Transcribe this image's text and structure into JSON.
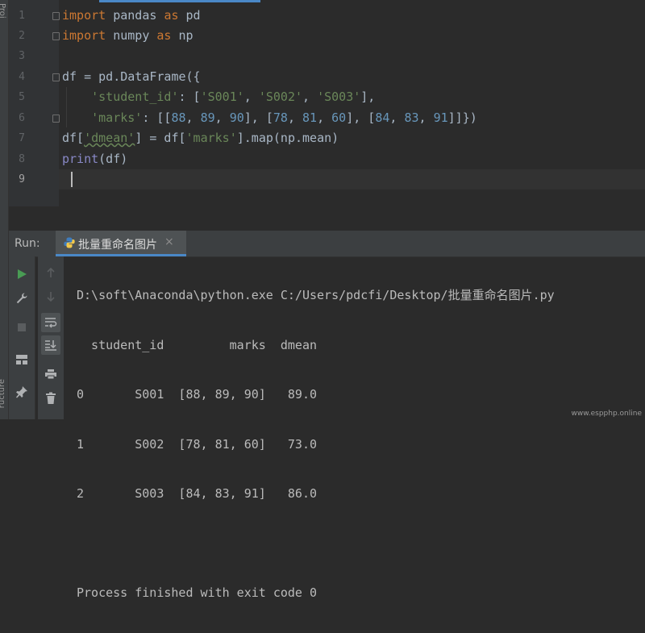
{
  "left_strip": {
    "top_label": "Proj",
    "bottom_label": "ructure"
  },
  "editor": {
    "line_numbers": [
      "1",
      "2",
      "3",
      "4",
      "5",
      "6",
      "7",
      "8",
      "9"
    ],
    "lines": {
      "l1": [
        "import",
        " pandas ",
        "as",
        " pd"
      ],
      "l2": [
        "import",
        " numpy ",
        "as",
        " np"
      ],
      "l4": [
        "df = pd.DataFrame({"
      ],
      "l5": [
        "    ",
        "'student_id'",
        ": [",
        "'S001'",
        ", ",
        "'S002'",
        ", ",
        "'S003'",
        "],"
      ],
      "l6": [
        "    ",
        "'marks'",
        ": [[",
        "88",
        ", ",
        "89",
        ", ",
        "90",
        "], [",
        "78",
        ", ",
        "81",
        ", ",
        "60",
        "], [",
        "84",
        ", ",
        "83",
        ", ",
        "91",
        "]]})"
      ],
      "l7": [
        "df[",
        "'dmean'",
        "] = df[",
        "'marks'",
        "].map(np.mean)"
      ],
      "l8": [
        "print",
        "(df)"
      ]
    }
  },
  "run": {
    "label": "Run:",
    "tab_label": "批量重命名图片",
    "tab_close": "×",
    "output": [
      "D:\\soft\\Anaconda\\python.exe C:/Users/pdcfi/Desktop/批量重命名图片.py",
      "  student_id         marks  dmean",
      "0       S001  [88, 89, 90]   89.0",
      "1       S002  [78, 81, 60]   73.0",
      "2       S003  [84, 83, 91]   86.0",
      "",
      "Process finished with exit code 0"
    ],
    "tools_left": [
      "run-icon",
      "wrench-icon",
      "stop-icon",
      "layout-icon",
      "pin-icon"
    ],
    "tools_right": [
      "arrow-up-icon",
      "arrow-down-icon",
      "soft-wrap-icon",
      "scroll-to-end-icon",
      "print-icon",
      "trash-icon"
    ]
  },
  "watermark": "www.espphp.online",
  "colors": {
    "keyword": "#cc7832",
    "string": "#6a8759",
    "number": "#6897bb",
    "builtin": "#8888c6",
    "text": "#a9b7c6",
    "accent": "#4a88c7",
    "run_green": "#499c54"
  }
}
